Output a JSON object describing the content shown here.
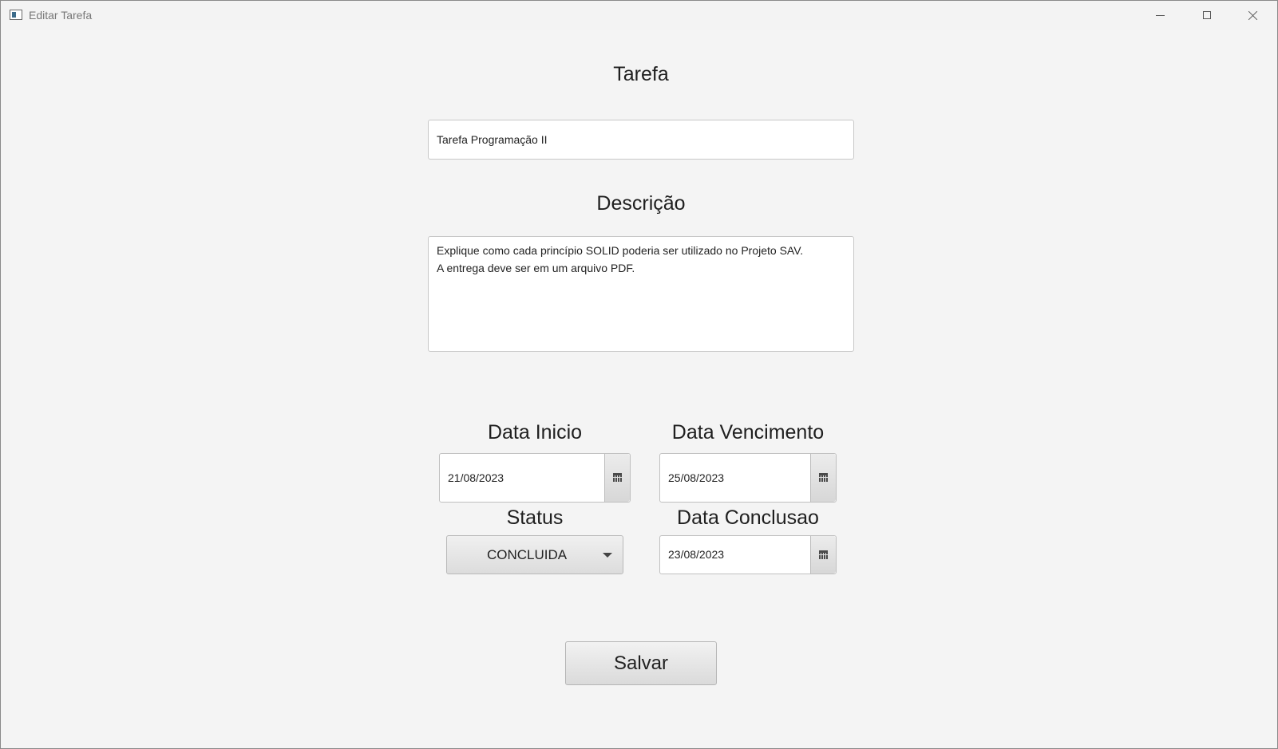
{
  "window": {
    "title": "Editar Tarefa",
    "controls": [
      "minimize-icon",
      "maximize-icon",
      "close-icon"
    ]
  },
  "form": {
    "tarefa_label": "Tarefa",
    "tarefa_value": "Tarefa Programação II",
    "descricao_label": "Descrição",
    "descricao_value": "Explique como cada princípio SOLID poderia ser utilizado no Projeto SAV.\nA entrega deve ser em um arquivo PDF.",
    "data_inicio_label": "Data Inicio",
    "data_inicio_value": "21/08/2023",
    "data_vencimento_label": "Data Vencimento",
    "data_vencimento_value": "25/08/2023",
    "status_label": "Status",
    "status_value": "CONCLUIDA",
    "data_conclusao_label": "Data Conclusao",
    "data_conclusao_value": "23/08/2023",
    "save_label": "Salvar"
  }
}
